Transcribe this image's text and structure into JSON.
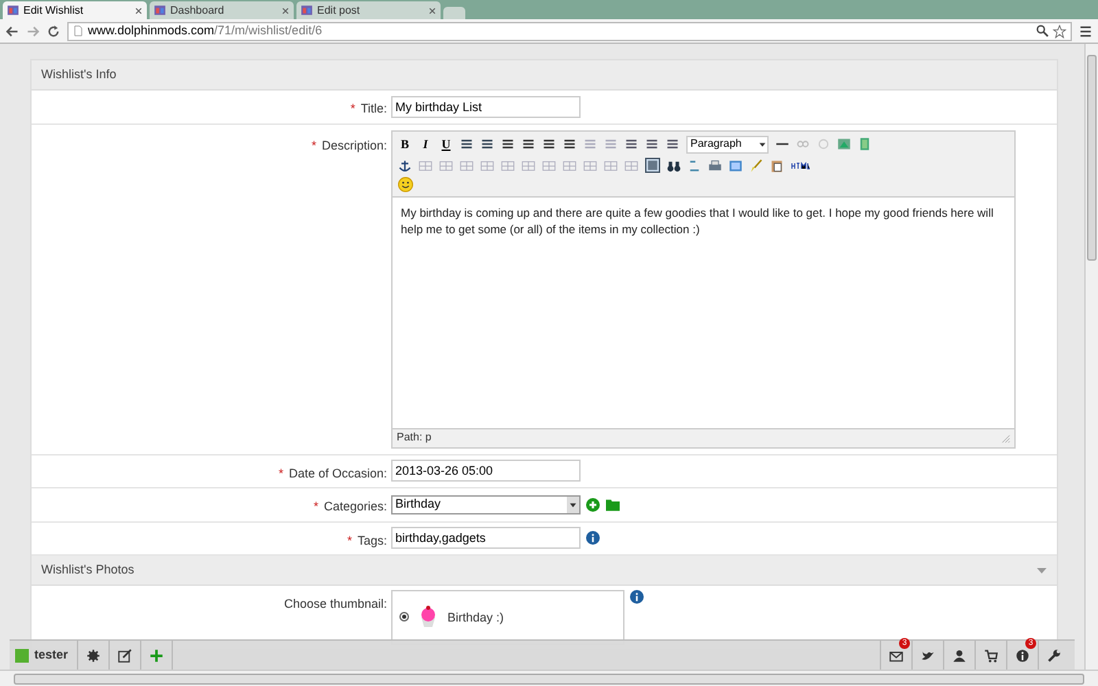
{
  "browser": {
    "tabs": [
      {
        "label": "Edit Wishlist",
        "selected": true
      },
      {
        "label": "Dashboard",
        "selected": false
      },
      {
        "label": "Edit post",
        "selected": false
      }
    ],
    "url_host": "www.dolphinmods.com",
    "url_path": "/71/m/wishlist/edit/6"
  },
  "sections": [
    {
      "title": "Wishlist's Info",
      "fields": [
        {
          "kind": "text",
          "label": "Title:",
          "marker": "*",
          "value": "My birthday List"
        },
        {
          "kind": "editor",
          "label": "Description:",
          "marker": "*",
          "format": "Paragraph",
          "toolbar_text": [
            "B",
            "I",
            "U"
          ],
          "body": "My birthday is coming up and there are quite a few goodies that I would like to get. I hope my good friends here will help me to get some (or all) of the items in my collection :)",
          "path": "Path: p"
        },
        {
          "kind": "text",
          "label": "Date of Occasion:",
          "marker": "*",
          "value": "2013-03-26 05:00"
        },
        {
          "kind": "select",
          "label": "Categories:",
          "marker": "*",
          "value": "Birthday"
        },
        {
          "kind": "text",
          "label": "Tags:",
          "marker": "*",
          "value": "birthday,gadgets",
          "info": true
        }
      ]
    },
    {
      "title": "Wishlist's Photos",
      "fields": [
        {
          "kind": "thumbnail",
          "label": "Choose thumbnail:",
          "option": "Birthday :)",
          "selected": true,
          "info": true
        }
      ]
    }
  ],
  "bottom_bar": {
    "user": "tester",
    "badges": [
      {
        "count": "3"
      },
      {
        "count": "3"
      }
    ]
  }
}
